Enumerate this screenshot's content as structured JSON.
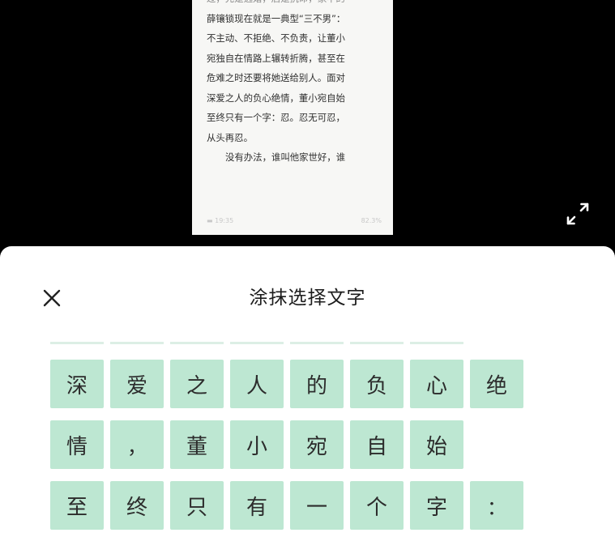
{
  "document": {
    "lines": [
      {
        "text": "过，先是逃婚，后是抗命，家中的",
        "cls": "faint"
      },
      {
        "text": "薛镶锁现在就是一典型“三不男”：",
        "cls": ""
      },
      {
        "text": "不主动、不拒绝、不负责，让董小",
        "cls": ""
      },
      {
        "text": "宛独自在情路上辗转折腾，甚至在",
        "cls": ""
      },
      {
        "text": "危难之时还要将她送给别人。面对",
        "cls": ""
      },
      {
        "text": "深爱之人的负心绝情，董小宛自始",
        "cls": ""
      },
      {
        "text": "至终只有一个字：忍。忍无可忍，",
        "cls": ""
      },
      {
        "text": "从头再忍。",
        "cls": ""
      },
      {
        "text": "没有办法，谁叫他家世好，谁",
        "cls": "indent"
      }
    ],
    "status_left": "▬ 19:35",
    "status_right": "82.3%"
  },
  "sheet": {
    "title": "涂抹选择文字",
    "rows": [
      [
        "深",
        "爱",
        "之",
        "人",
        "的",
        "负",
        "心",
        "绝"
      ],
      [
        "情",
        "，",
        "董",
        "小",
        "宛",
        "自",
        "始"
      ],
      [
        "至",
        "终",
        "只",
        "有",
        "一",
        "个",
        "字",
        "："
      ]
    ]
  },
  "icons": {
    "close": "close-icon",
    "expand": "expand-arrows-icon"
  },
  "colors": {
    "background": "#000000",
    "sheet": "#ffffff",
    "highlight": "#bde7d2",
    "text": "#2c2c2c"
  }
}
